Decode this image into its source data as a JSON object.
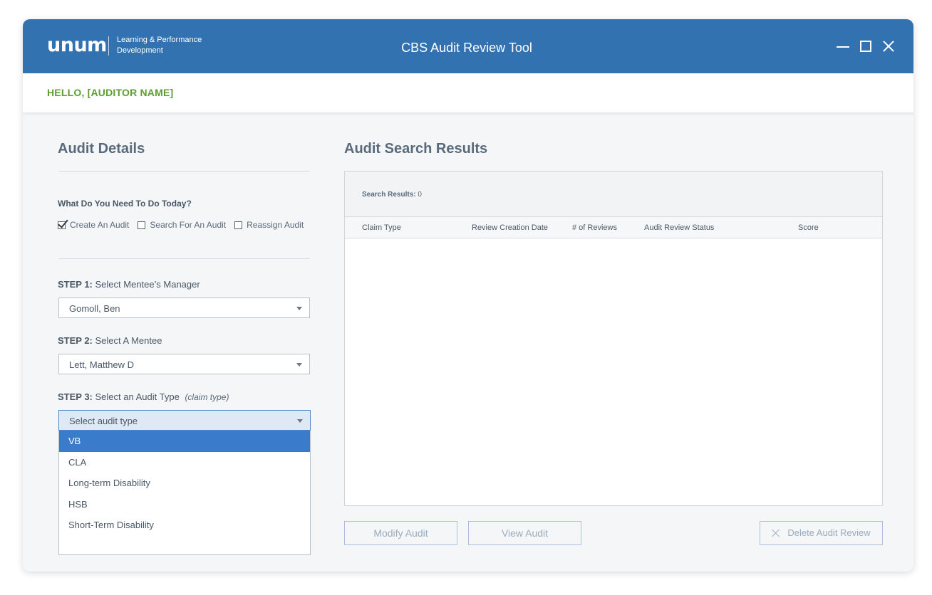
{
  "header": {
    "logo_text": "unum",
    "logo_subtitle_line1": "Learning & Performance",
    "logo_subtitle_line2": "Development",
    "app_title": "CBS Audit Review Tool",
    "greeting": "HELLO, [AUDITOR NAME]"
  },
  "audit_details": {
    "title": "Audit Details",
    "question": "What Do You Need To Do Today?",
    "options": [
      {
        "label": "Create An Audit",
        "checked": true
      },
      {
        "label": "Search For An Audit",
        "checked": false
      },
      {
        "label": "Reassign Audit",
        "checked": false
      }
    ],
    "step1": {
      "prefix": "STEP 1:",
      "text": "Select Mentee’s Manager",
      "value": "Gomoll, Ben"
    },
    "step2": {
      "prefix": "STEP 2:",
      "text": "Select A Mentee",
      "value": "Lett, Matthew D"
    },
    "step3": {
      "prefix": "STEP 3:",
      "text": "Select an Audit Type",
      "hint": "(claim type)",
      "placeholder": "Select audit type",
      "options": [
        "VB",
        "CLA",
        "Long-term Disability",
        "HSB",
        "Short-Term Disability"
      ],
      "highlighted": "VB"
    }
  },
  "results": {
    "title": "Audit Search Results",
    "count_label": "Search Results:",
    "count_value": "0",
    "columns": [
      "Claim Type",
      "Review Creation Date",
      "# of Reviews",
      "Audit Review Status",
      "Score"
    ],
    "rows": []
  },
  "actions": {
    "modify": "Modify Audit",
    "view": "View Audit",
    "delete": "Delete Audit Review"
  },
  "colors": {
    "titlebar": "#3372b1",
    "greeting": "#5e9c34",
    "dropdown_selected": "#3a7bcc"
  }
}
